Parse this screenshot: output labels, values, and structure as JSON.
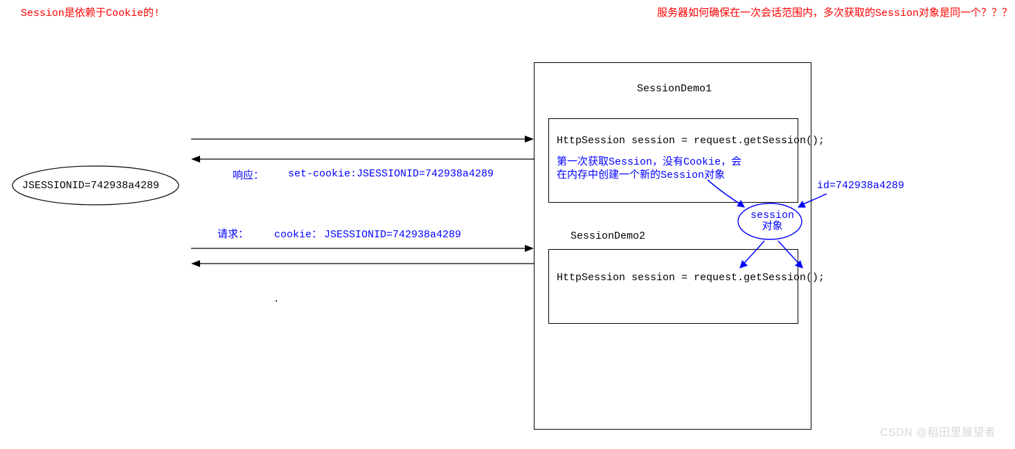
{
  "heading_left": "Session是依赖于Cookie的!",
  "heading_right": "服务器如何确保在一次会话范围内，多次获取的Session对象是同一个？？？",
  "client_cookie": "JSESSIONID=742938a4289",
  "response_label": "响应：",
  "response_header": "set-cookie:JSESSIONID=742938a4289",
  "request_label": "请求：",
  "request_cookie_label": "cookie：",
  "request_cookie_value": "JSESSIONID=742938a4289",
  "server_title_1": "SessionDemo1",
  "server_code_1": "HttpSession session = request.getSession();",
  "server_note_1_line1": "第一次获取Session，没有Cookie，会",
  "server_note_1_line2": "在内存中创建一个新的Session对象",
  "server_title_2": "SessionDemo2",
  "server_code_2": "HttpSession session = request.getSession();",
  "session_obj_line1": "session",
  "session_obj_line2": "对象",
  "session_id": "id=742938a4289",
  "watermark": "CSDN @稻田里展望者",
  "colors": {
    "red": "#ff0000",
    "blue": "#0000ff",
    "black": "#000000",
    "watermark": "#d8d8d8"
  }
}
